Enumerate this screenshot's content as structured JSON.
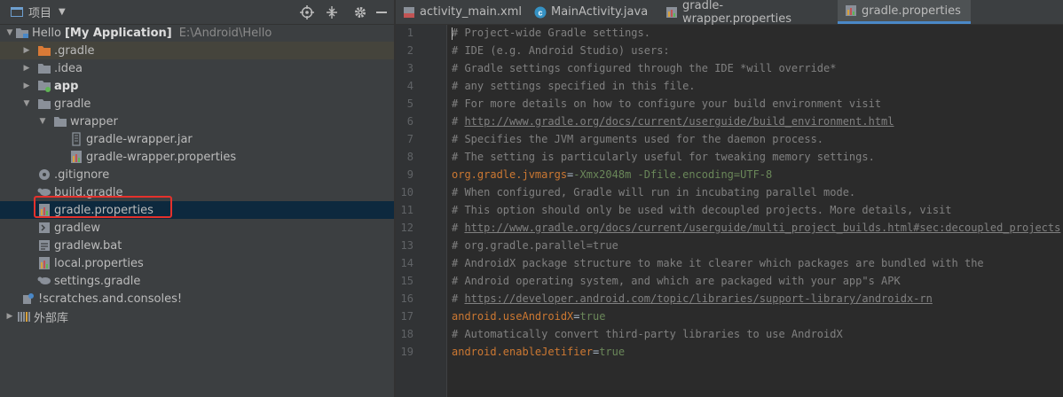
{
  "project_pane": {
    "title": "项目",
    "toolbar_icons": [
      "locate-icon",
      "collapse-icon",
      "gear-icon",
      "minimize-icon"
    ]
  },
  "tree": [
    {
      "label": "Hello",
      "bold_label": "[My Application]",
      "path": "E:\\Android\\Hello",
      "icon": "folder-module-icon",
      "expanded": true
    },
    {
      "label": ".gradle",
      "icon": "folder-orange-icon",
      "expanded": false
    },
    {
      "label": ".idea",
      "icon": "folder-icon",
      "expanded": false
    },
    {
      "label": "app",
      "icon": "folder-app-icon",
      "expanded": false
    },
    {
      "label": "gradle",
      "icon": "folder-icon",
      "expanded": true
    },
    {
      "label": "wrapper",
      "icon": "folder-icon",
      "expanded": true
    },
    {
      "label": "gradle-wrapper.jar",
      "icon": "jar-icon"
    },
    {
      "label": "gradle-wrapper.properties",
      "icon": "properties-icon"
    },
    {
      "label": ".gitignore",
      "icon": "gitignore-icon"
    },
    {
      "label": "build.gradle",
      "icon": "gradle-elephant-icon"
    },
    {
      "label": "gradle.properties",
      "icon": "properties-icon"
    },
    {
      "label": "gradlew",
      "icon": "shell-file-icon"
    },
    {
      "label": "gradlew.bat",
      "icon": "text-file-icon"
    },
    {
      "label": "local.properties",
      "icon": "properties-icon"
    },
    {
      "label": "settings.gradle",
      "icon": "gradle-elephant-icon"
    },
    {
      "label": "!scratches.and.consoles!",
      "icon": "scratches-icon"
    },
    {
      "label": "外部库",
      "icon": "library-icon",
      "expanded": false
    }
  ],
  "editor_tabs": [
    {
      "label": "activity_main.xml",
      "icon": "xml-layout-icon"
    },
    {
      "label": "MainActivity.java",
      "icon": "java-class-icon"
    },
    {
      "label": "gradle-wrapper.properties",
      "icon": "properties-icon"
    },
    {
      "label": "gradle.properties",
      "icon": "properties-icon",
      "active": true
    }
  ],
  "code_lines": [
    {
      "n": "1",
      "type": "comment",
      "text": "# Project-wide Gradle settings."
    },
    {
      "n": "2",
      "type": "comment",
      "text": "# IDE (e.g. Android Studio) users:"
    },
    {
      "n": "3",
      "type": "comment",
      "text": "# Gradle settings configured through the IDE *will override*"
    },
    {
      "n": "4",
      "type": "comment",
      "text": "# any settings specified in this file."
    },
    {
      "n": "5",
      "type": "comment",
      "text": "# For more details on how to configure your build environment visit"
    },
    {
      "n": "6",
      "type": "link",
      "prefix": "# ",
      "text": "http://www.gradle.org/docs/current/userguide/build_environment.html"
    },
    {
      "n": "7",
      "type": "comment",
      "text": "# Specifies the JVM arguments used for the daemon process."
    },
    {
      "n": "8",
      "type": "comment",
      "text": "# The setting is particularly useful for tweaking memory settings."
    },
    {
      "n": "9",
      "type": "prop",
      "key": "org.gradle.jvmargs",
      "value": "-Xmx2048m -Dfile.encoding=UTF-8"
    },
    {
      "n": "10",
      "type": "comment",
      "text": "# When configured, Gradle will run in incubating parallel mode."
    },
    {
      "n": "11",
      "type": "comment",
      "text": "# This option should only be used with decoupled projects. More details, visit"
    },
    {
      "n": "12",
      "type": "link",
      "prefix": "# ",
      "text": "http://www.gradle.org/docs/current/userguide/multi_project_builds.html#sec:decoupled_projects"
    },
    {
      "n": "13",
      "type": "comment",
      "text": "# org.gradle.parallel=true"
    },
    {
      "n": "14",
      "type": "comment",
      "text": "# AndroidX package structure to make it clearer which packages are bundled with the"
    },
    {
      "n": "15",
      "type": "comment",
      "text": "# Android operating system, and which are packaged with your app\"s APK"
    },
    {
      "n": "16",
      "type": "link",
      "prefix": "# ",
      "text": "https://developer.android.com/topic/libraries/support-library/androidx-rn"
    },
    {
      "n": "17",
      "type": "prop",
      "key": "android.useAndroidX",
      "value": "true"
    },
    {
      "n": "18",
      "type": "comment",
      "text": "# Automatically convert third-party libraries to use AndroidX"
    },
    {
      "n": "19",
      "type": "prop",
      "key": "android.enableJetifier",
      "value": "true"
    }
  ],
  "colors": {
    "highlight_box": "#e5312c",
    "selection": "#0d293e",
    "comment": "#808080",
    "key": "#cc7832",
    "value": "#6a8759"
  }
}
